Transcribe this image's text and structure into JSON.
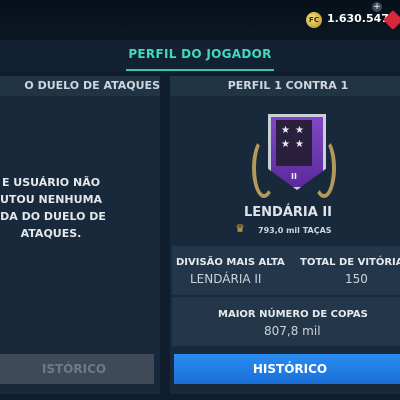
{
  "topbar": {
    "coins": "1.630.547",
    "coin_icon_label": "FC"
  },
  "header": {
    "title": "PERFIL DO JOGADOR"
  },
  "left_panel": {
    "title": "O DUELO DE ATAQUES",
    "message_lines": [
      "E USUÁRIO NÃO",
      "UTOU NENHUMA",
      "IDA DO DUELO DE",
      "ATAQUES."
    ],
    "button": "ISTÓRICO"
  },
  "right_panel": {
    "title": "PERFIL 1 CONTRA 1",
    "badge_roman": "II",
    "rank": "LENDÁRIA II",
    "trophies": "793,0 mil TAÇAS",
    "stats": {
      "highest_division_label": "DIVISÃO MAIS ALTA",
      "highest_division_value": "LENDÁRIA II",
      "total_wins_label": "TOTAL DE VITÓRIA",
      "total_wins_value": "150",
      "most_cups_label": "MAIOR NÚMERO DE COPAS",
      "most_cups_value": "807,8 mil"
    },
    "button": "HISTÓRICO"
  },
  "colors": {
    "accent": "#41d9c4",
    "button_primary": "#1f7fe6",
    "badge_purple": "#6d35b3"
  }
}
